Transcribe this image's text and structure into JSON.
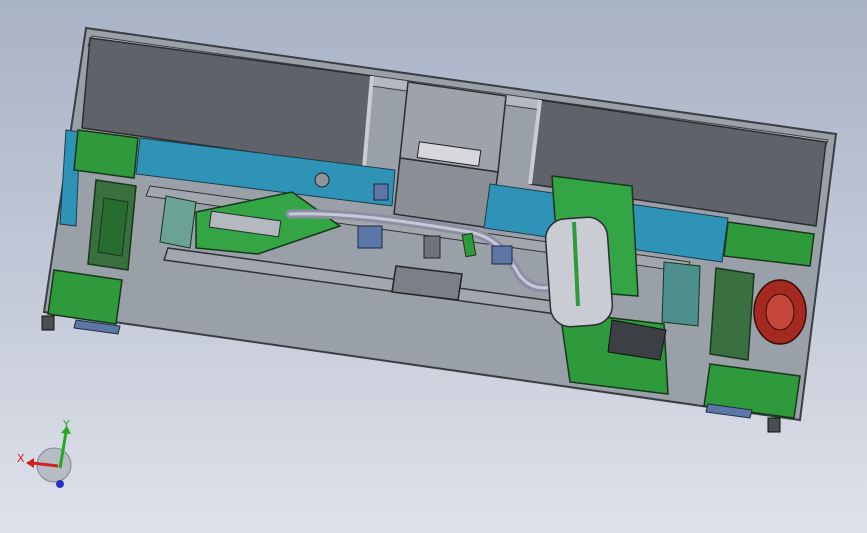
{
  "viewport": {
    "background_top": "#a9b3c6",
    "background_bottom": "#dfe2ea"
  },
  "model": {
    "colors": {
      "frame": "#8e949c",
      "panel": "#6a6e74",
      "rail": "#2f8fb0",
      "bracket": "#2f9a3a",
      "motor": "#b0281f",
      "block": "#5c77a6"
    }
  },
  "triad": {
    "x_label": "X",
    "y_label": "Y",
    "x_color": "#cc2222",
    "y_color": "#22aa22",
    "z_color": "#2233cc"
  }
}
